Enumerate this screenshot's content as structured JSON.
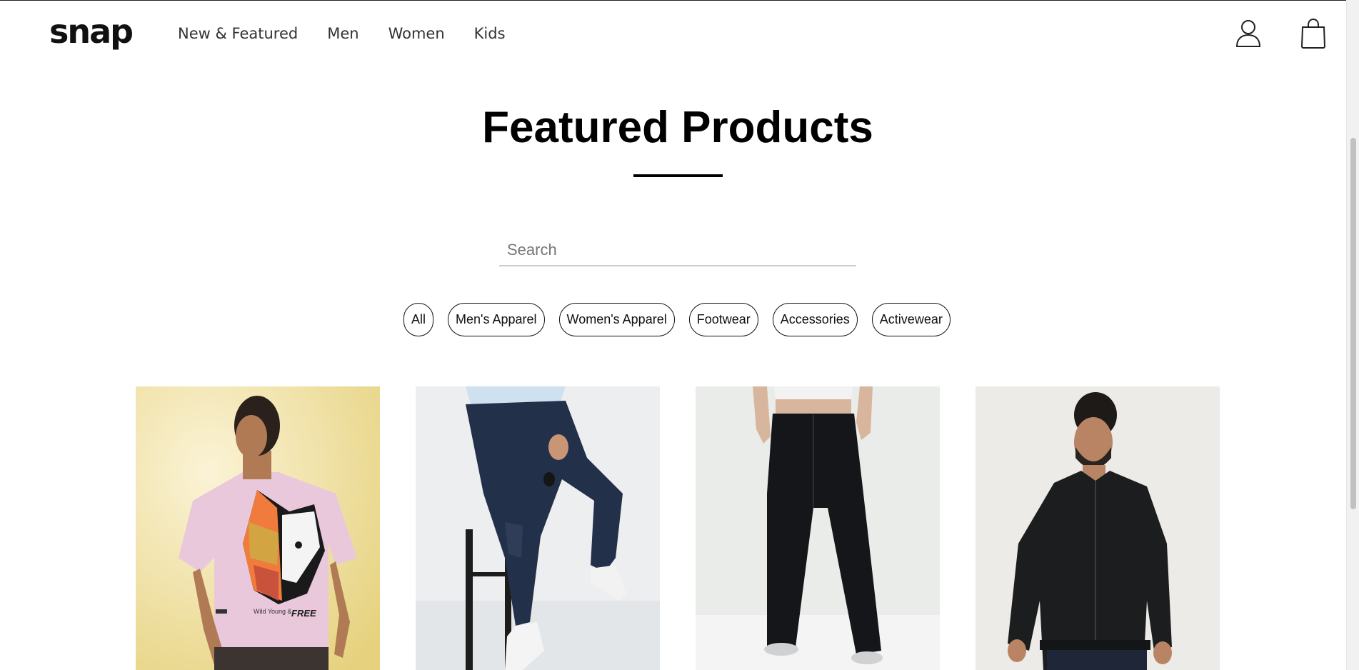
{
  "brand": {
    "logo": "snap"
  },
  "nav": {
    "items": [
      {
        "label": "New & Featured"
      },
      {
        "label": "Men"
      },
      {
        "label": "Women"
      },
      {
        "label": "Kids"
      }
    ]
  },
  "header_icons": {
    "account": "user-icon",
    "cart": "shopping-bag-icon"
  },
  "page": {
    "title": "Featured Products"
  },
  "search": {
    "placeholder": "Search",
    "value": ""
  },
  "filters": [
    {
      "label": "All"
    },
    {
      "label": "Men's Apparel"
    },
    {
      "label": "Women's Apparel"
    },
    {
      "label": "Footwear"
    },
    {
      "label": "Accessories"
    },
    {
      "label": "Activewear"
    }
  ],
  "products": [
    {
      "image": "man-pink-graphic-tee",
      "print_text": "Wild Young & FREE",
      "bg_color": "#e8d890"
    },
    {
      "image": "man-dark-denim-jeans",
      "bg_color": "#e9ebed"
    },
    {
      "image": "woman-black-wide-leg-pants",
      "bg_color": "#eceeec"
    },
    {
      "image": "man-black-bomber-jacket",
      "bg_color": "#ecebe9"
    }
  ],
  "colors": {
    "text": "#111111",
    "accent": "#000000",
    "search_underline": "#cccccc"
  }
}
